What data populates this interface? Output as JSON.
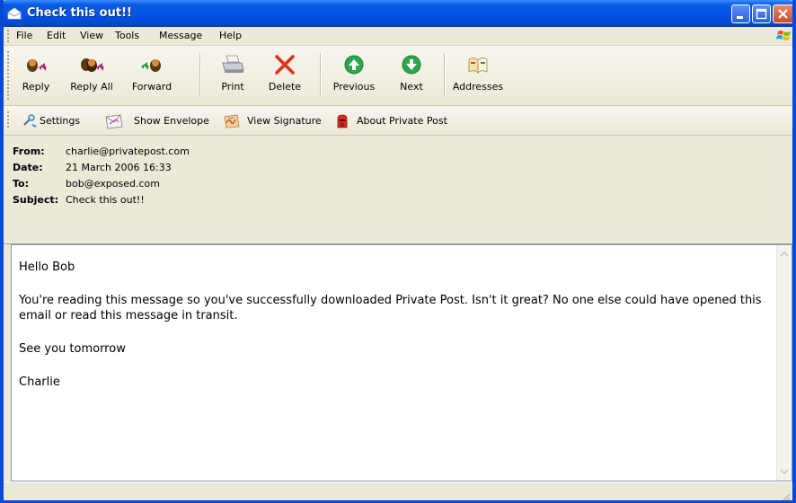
{
  "window": {
    "title": "Check this out!!",
    "controls": [
      "minimize",
      "maximize",
      "close"
    ]
  },
  "menu": {
    "items": [
      "File",
      "Edit",
      "View",
      "Tools",
      "Message",
      "Help"
    ]
  },
  "toolbar": {
    "buttons": [
      {
        "label": "Reply",
        "icon": "reply-icon"
      },
      {
        "label": "Reply All",
        "icon": "reply-all-icon"
      },
      {
        "label": "Forward",
        "icon": "forward-icon"
      },
      {
        "label": "Print",
        "icon": "print-icon"
      },
      {
        "label": "Delete",
        "icon": "delete-icon"
      },
      {
        "label": "Previous",
        "icon": "previous-icon"
      },
      {
        "label": "Next",
        "icon": "next-icon"
      },
      {
        "label": "Addresses",
        "icon": "address-book-icon"
      }
    ]
  },
  "secondary_toolbar": {
    "buttons": [
      {
        "label": "Settings",
        "icon": "settings-icon"
      },
      {
        "label": "Show Envelope",
        "icon": "envelope-icon"
      },
      {
        "label": "View Signature",
        "icon": "signature-icon"
      },
      {
        "label": "About Private Post",
        "icon": "private-post-icon"
      }
    ]
  },
  "header": {
    "from_label": "From:",
    "from": "charlie@privatepost.com",
    "date_label": "Date:",
    "date": "21 March 2006 16:33",
    "to_label": "To:",
    "to": "bob@exposed.com",
    "subject_label": "Subject:",
    "subject": "Check this out!!"
  },
  "message": {
    "paragraphs": [
      "Hello Bob",
      "You're reading this message so you've successfully downloaded Private Post. Isn't it great? No one else could have opened this email or read this message in transit.",
      "See you tomorrow",
      "Charlie"
    ]
  },
  "colors": {
    "titlebar": "#0553e6",
    "chrome": "#ece9d8",
    "delete": "#e0301e",
    "navigation": "#2ca84a"
  }
}
